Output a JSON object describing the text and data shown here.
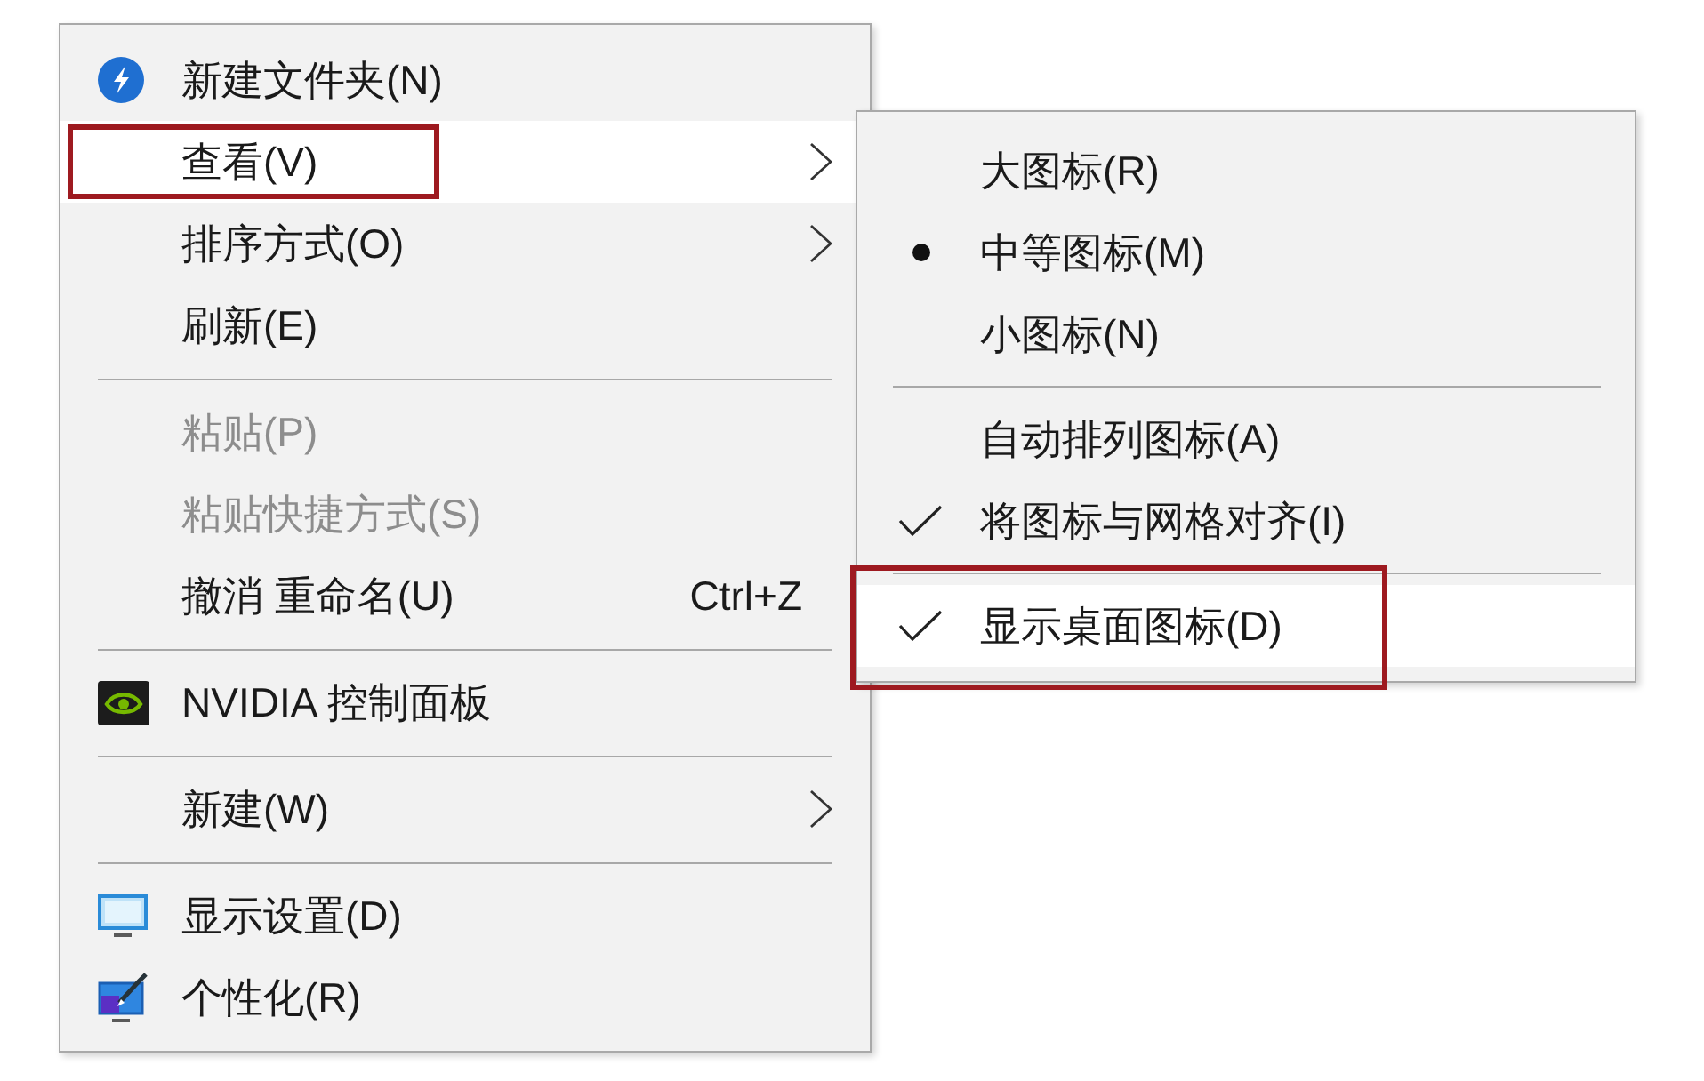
{
  "menu": {
    "sections": [
      {
        "items": [
          {
            "label": "新建文件夹(N)",
            "disabled": false,
            "hovered": false,
            "submenu": false,
            "annotated": false
          },
          {
            "label": "查看(V)",
            "disabled": false,
            "hovered": true,
            "submenu": true,
            "annotated": true
          },
          {
            "label": "排序方式(O)",
            "disabled": false,
            "hovered": false,
            "submenu": true,
            "annotated": false
          },
          {
            "label": "刷新(E)",
            "disabled": false,
            "hovered": false,
            "submenu": false,
            "annotated": false
          }
        ]
      },
      {
        "items": [
          {
            "label": "粘贴(P)",
            "disabled": true,
            "hovered": false,
            "submenu": false,
            "annotated": false
          },
          {
            "label": "粘贴快捷方式(S)",
            "disabled": true,
            "hovered": false,
            "submenu": false,
            "annotated": false
          },
          {
            "label": "撤消 重命名(U)",
            "shortcut": "Ctrl+Z",
            "disabled": false,
            "hovered": false,
            "submenu": false,
            "annotated": false
          }
        ]
      },
      {
        "items": [
          {
            "label": "NVIDIA 控制面板",
            "disabled": false,
            "hovered": false,
            "submenu": false,
            "annotated": false
          }
        ]
      },
      {
        "items": [
          {
            "label": "新建(W)",
            "disabled": false,
            "hovered": false,
            "submenu": true,
            "annotated": false
          }
        ]
      },
      {
        "items": [
          {
            "label": "显示设置(D)",
            "disabled": false,
            "hovered": false,
            "submenu": false,
            "annotated": false
          },
          {
            "label": "个性化(R)",
            "disabled": false,
            "hovered": false,
            "submenu": false,
            "annotated": false
          }
        ]
      }
    ]
  },
  "submenu": {
    "sections": [
      {
        "items": [
          {
            "kind": "radio",
            "label": "大图标(R)",
            "selected": false,
            "hovered": false,
            "annotated": false
          },
          {
            "kind": "radio",
            "label": "中等图标(M)",
            "selected": true,
            "hovered": false,
            "annotated": false
          },
          {
            "kind": "radio",
            "label": "小图标(N)",
            "selected": false,
            "hovered": false,
            "annotated": false
          }
        ]
      },
      {
        "items": [
          {
            "kind": "check",
            "label": "自动排列图标(A)",
            "checked": false,
            "hovered": false,
            "annotated": false
          },
          {
            "kind": "check",
            "label": "将图标与网格对齐(I)",
            "checked": true,
            "hovered": false,
            "annotated": false
          }
        ]
      },
      {
        "items": [
          {
            "kind": "check",
            "label": "显示桌面图标(D)",
            "checked": true,
            "hovered": true,
            "annotated": true
          }
        ]
      }
    ]
  }
}
